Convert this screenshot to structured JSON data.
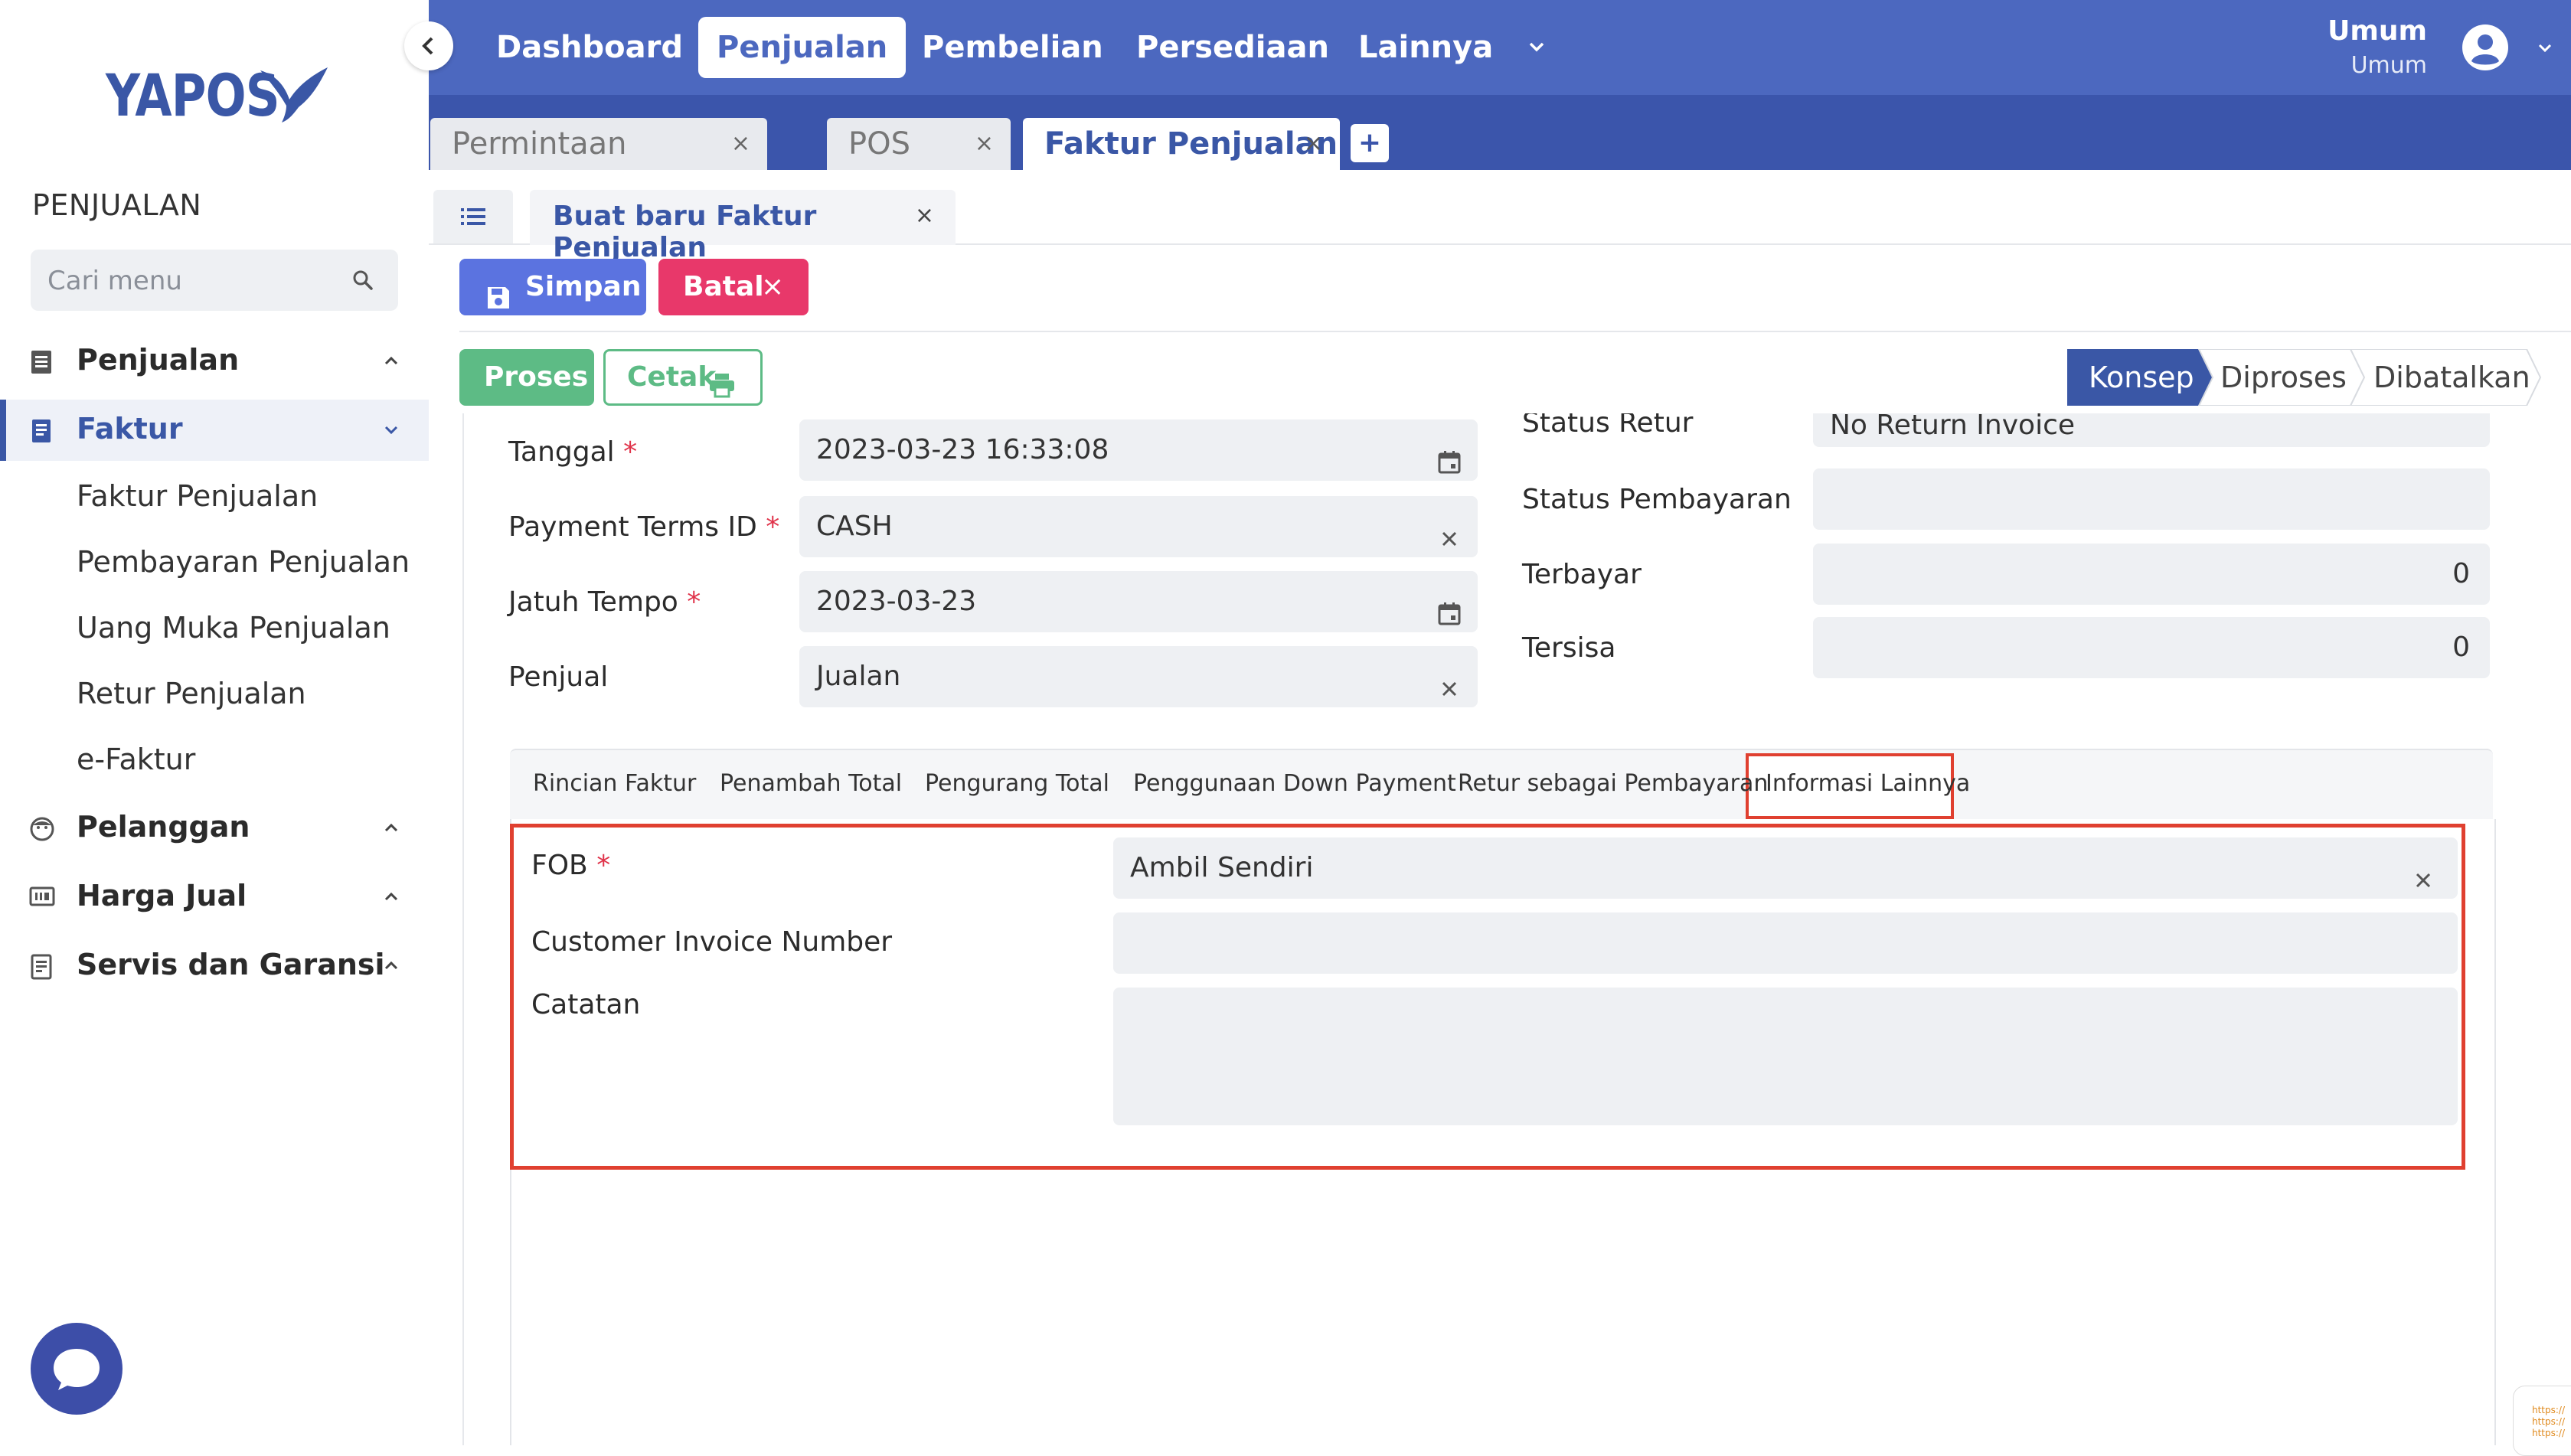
{
  "brand": {
    "logo_text": "YAPOS"
  },
  "sidebar": {
    "section_title": "PENJUALAN",
    "search_placeholder": "Cari menu",
    "items": [
      {
        "label": "Penjualan"
      },
      {
        "label": "Faktur"
      },
      {
        "label": "Pelanggan"
      },
      {
        "label": "Harga Jual"
      },
      {
        "label": "Servis dan Garansi"
      }
    ],
    "subitems": [
      "Faktur Penjualan",
      "Pembayaran Penjualan",
      "Uang Muka Penjualan",
      "Retur Penjualan",
      "e-Faktur"
    ]
  },
  "topnav": {
    "items": [
      "Dashboard",
      "Penjualan",
      "Pembelian",
      "Persediaan",
      "Lainnya"
    ],
    "active": "Penjualan",
    "user_name": "Umum",
    "user_role": "Umum"
  },
  "doc_tabs": [
    {
      "label": "Permintaan Pembelian",
      "close": "×"
    },
    {
      "label": "POS",
      "close": "×"
    },
    {
      "label": "Faktur Penjualan",
      "close": "×"
    }
  ],
  "add_tab_label": "+",
  "form_tab": {
    "label": "Buat baru Faktur Penjualan",
    "close": "×"
  },
  "toolbar": {
    "save_label": "Simpan",
    "cancel_label": "Batal",
    "cancel_icon": "×",
    "process_label": "Proses",
    "print_label": "Cetak"
  },
  "status_steps": [
    "Konsep",
    "Diproses",
    "Dibatalkan"
  ],
  "status_active": "Konsep",
  "colors": {
    "primary": "#4c68bf",
    "save": "#5b73e0",
    "cancel": "#e8386a",
    "success": "#5dbb85",
    "highlight": "#e04030",
    "required": "#e0334a"
  },
  "form_left": [
    {
      "label": "Tanggal",
      "required": "*",
      "value": "2023-03-23  16:33:08",
      "icon": "calendar-icon"
    },
    {
      "label": "Payment Terms ID",
      "required": "*",
      "value": "CASH",
      "icon": "clear-icon"
    },
    {
      "label": "Jatuh Tempo",
      "required": "*",
      "value": "2023-03-23",
      "icon": "calendar-icon"
    },
    {
      "label": "Penjual",
      "required": "",
      "value": "Jualan",
      "icon": "clear-icon"
    }
  ],
  "form_right": [
    {
      "label": "Status Retur",
      "value": "No Return Invoice"
    },
    {
      "label": "Status Pembayaran",
      "value": ""
    },
    {
      "label": "Terbayar",
      "value": "0"
    },
    {
      "label": "Tersisa",
      "value": "0"
    }
  ],
  "inner_tabs": [
    "Rincian Faktur",
    "Penambah Total",
    "Pengurang Total",
    "Penggunaan Down Payment",
    "Retur sebagai Pembayaran",
    "Informasi Lainnya"
  ],
  "inner_tab_active": "Informasi Lainnya",
  "other_info": {
    "fob_label": "FOB",
    "fob_required": "*",
    "fob_value": "Ambil Sendiri",
    "customer_invoice_label": "Customer Invoice Number",
    "customer_invoice_value": "",
    "notes_label": "Catatan",
    "notes_value": ""
  },
  "corner_note_lines": [
    "https://",
    "https://",
    "https://"
  ]
}
